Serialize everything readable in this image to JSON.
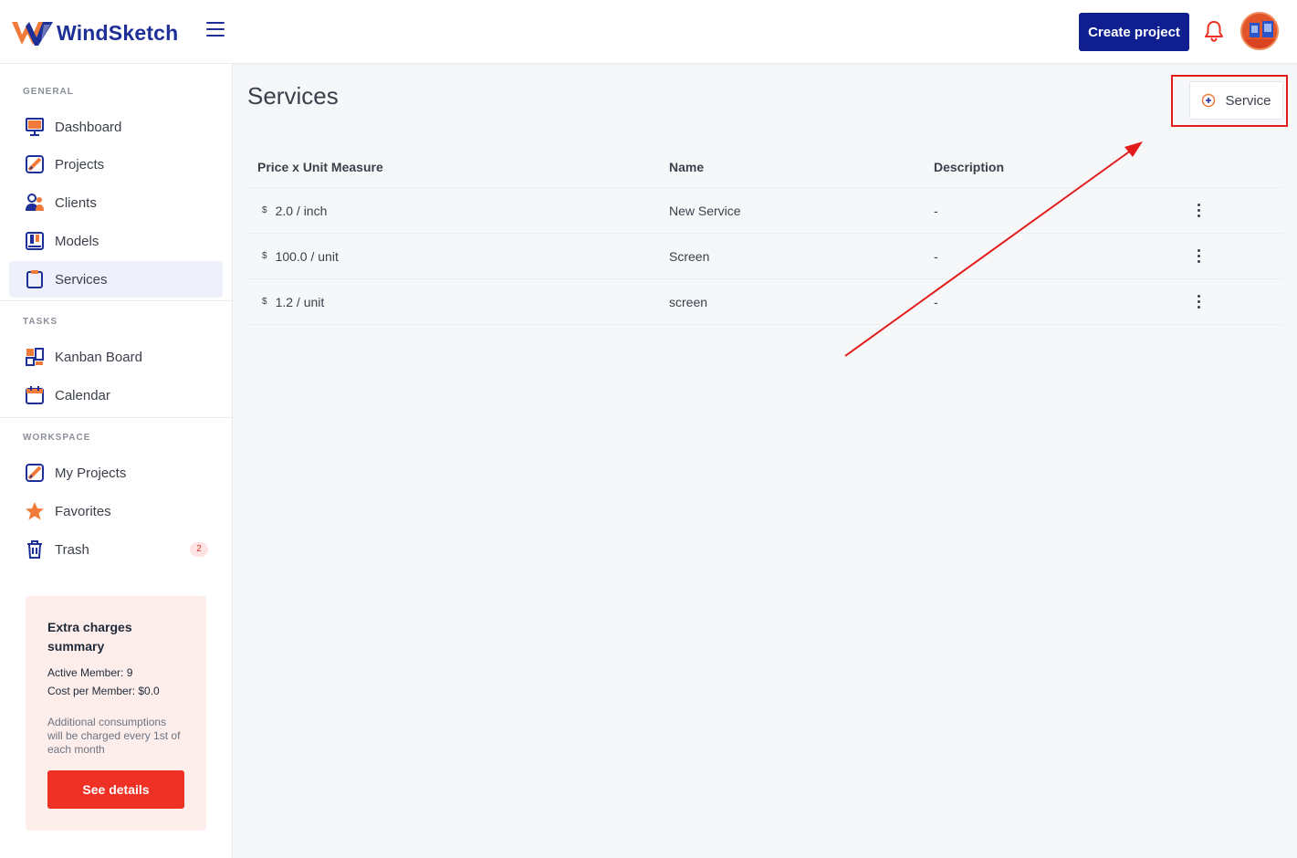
{
  "header": {
    "brand": "WindSketch",
    "create_label": "Create project"
  },
  "sidebar": {
    "sections": {
      "general": "GENERAL",
      "tasks": "TASKS",
      "workspace": "WORKSPACE"
    },
    "items": [
      {
        "label": "Dashboard",
        "icon": "dashboard-icon"
      },
      {
        "label": "Projects",
        "icon": "projects-icon"
      },
      {
        "label": "Clients",
        "icon": "clients-icon"
      },
      {
        "label": "Models",
        "icon": "models-icon"
      },
      {
        "label": "Services",
        "icon": "services-icon",
        "active": true
      },
      {
        "label": "Kanban Board",
        "icon": "kanban-icon"
      },
      {
        "label": "Calendar",
        "icon": "calendar-icon"
      },
      {
        "label": "My Projects",
        "icon": "my-projects-icon"
      },
      {
        "label": "Favorites",
        "icon": "star-icon"
      },
      {
        "label": "Trash",
        "icon": "trash-icon",
        "badge": "2"
      }
    ],
    "charges": {
      "title": "Extra charges summary",
      "active_member": "Active Member: 9",
      "cost_per_member": "Cost per Member: $0.0",
      "note": "Additional consumptions will be charged every 1st of each month",
      "button": "See details"
    }
  },
  "main": {
    "title": "Services",
    "add_button": "Service",
    "columns": [
      "Price x Unit Measure",
      "Name",
      "Description"
    ],
    "rows": [
      {
        "currency": "$",
        "price": "2.0 / inch",
        "name": "New Service",
        "description": "-"
      },
      {
        "currency": "$",
        "price": "100.0 / unit",
        "name": "Screen",
        "description": "-"
      },
      {
        "currency": "$",
        "price": "1.2 / unit",
        "name": "screen",
        "description": "-"
      }
    ]
  },
  "colors": {
    "brand_blue": "#1e2f97",
    "accent_orange": "#f07a3a",
    "danger_red": "#ee3124",
    "annotation_red": "#e31b1b"
  }
}
